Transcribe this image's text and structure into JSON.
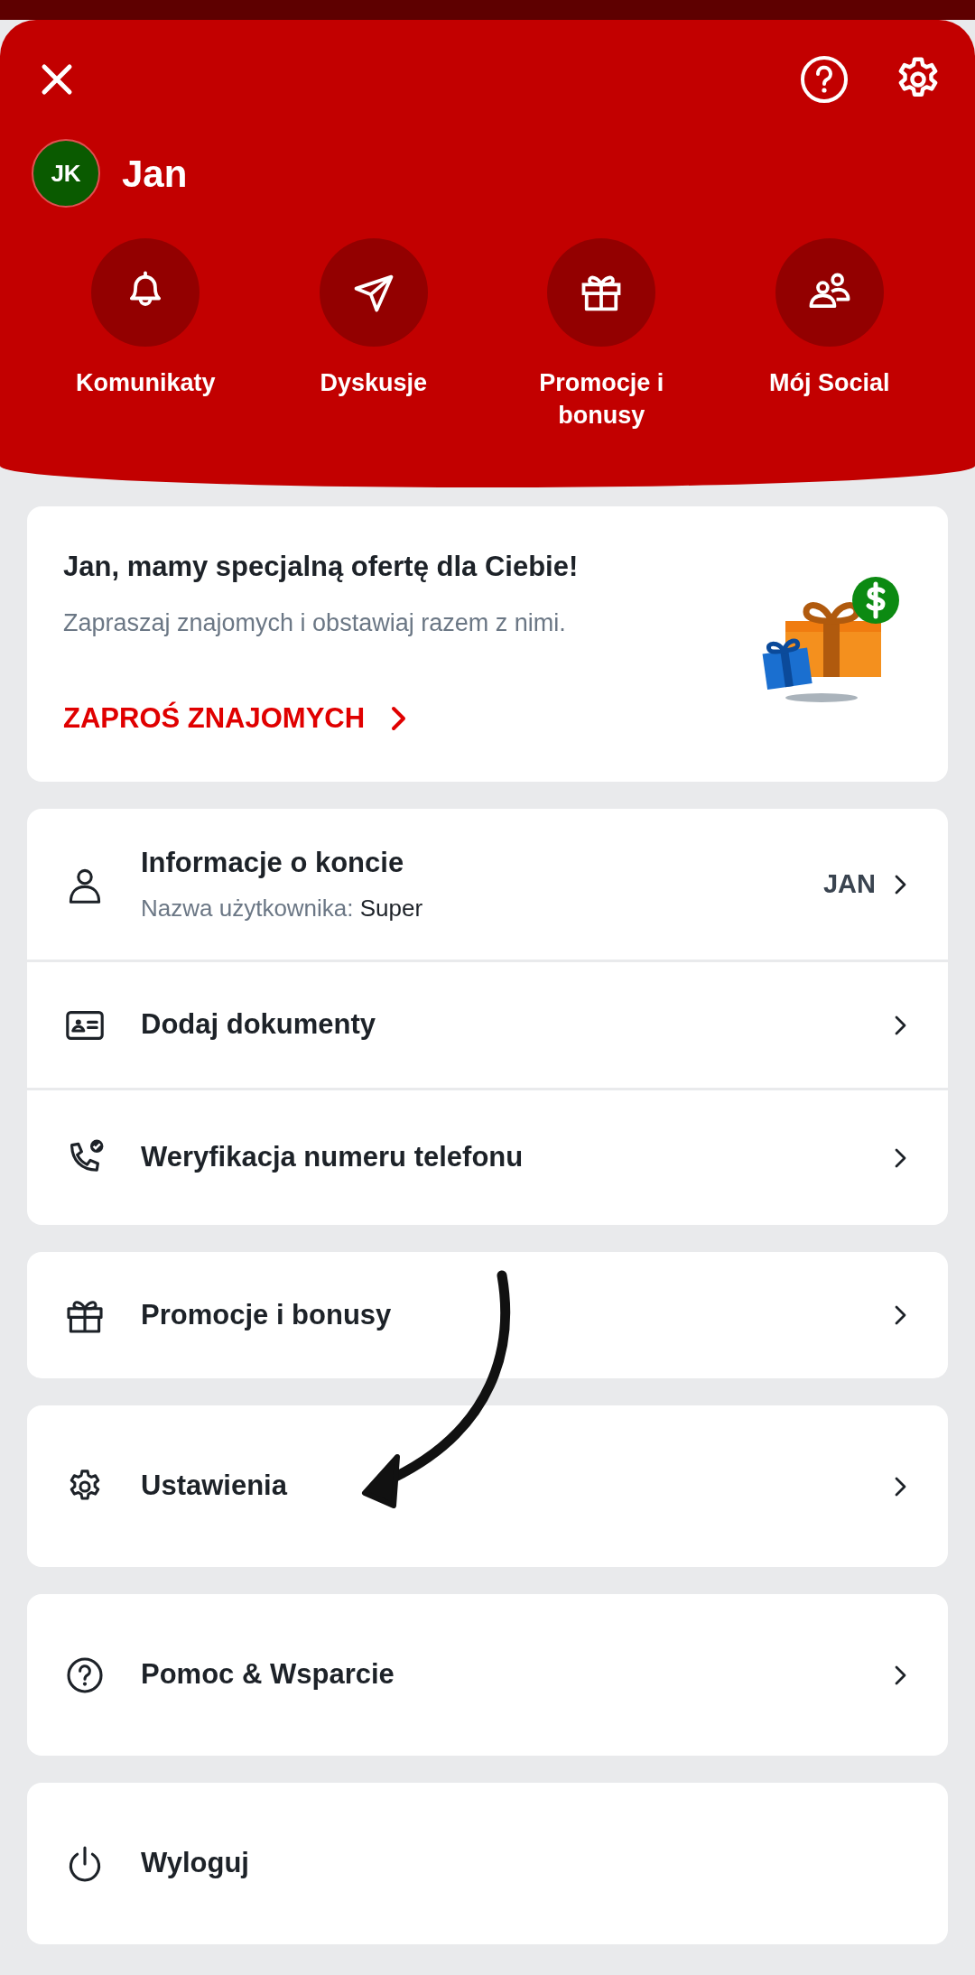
{
  "header": {
    "avatar_initials": "JK",
    "user_name": "Jan",
    "shortcuts": [
      {
        "label": "Komunikaty"
      },
      {
        "label": "Dyskusje"
      },
      {
        "label": "Promocje i bonusy"
      },
      {
        "label": "Mój Social"
      }
    ]
  },
  "promo_card": {
    "title": "Jan, mamy specjalną ofertę dla Ciebie!",
    "text": "Zapraszaj znajomych i obstawiaj razem z nimi.",
    "link": "ZAPROŚ ZNAJOMYCH"
  },
  "menu_groups": [
    {
      "rows": [
        {
          "title": "Informacje o koncie",
          "subtitle_label": "Nazwa użytkownika:",
          "subtitle_value": "Super",
          "value": "JAN",
          "chevron": true
        },
        {
          "title": "Dodaj dokumenty",
          "chevron": true
        },
        {
          "title": "Weryfikacja numeru telefonu",
          "chevron": true
        }
      ]
    },
    {
      "rows": [
        {
          "title": "Promocje i bonusy",
          "chevron": true
        }
      ]
    },
    {
      "rows": [
        {
          "title": "Ustawienia",
          "chevron": true
        }
      ]
    },
    {
      "rows": [
        {
          "title": "Pomoc & Wsparcie",
          "chevron": true
        }
      ]
    },
    {
      "rows": [
        {
          "title": "Wyloguj",
          "chevron": false
        }
      ]
    }
  ]
}
